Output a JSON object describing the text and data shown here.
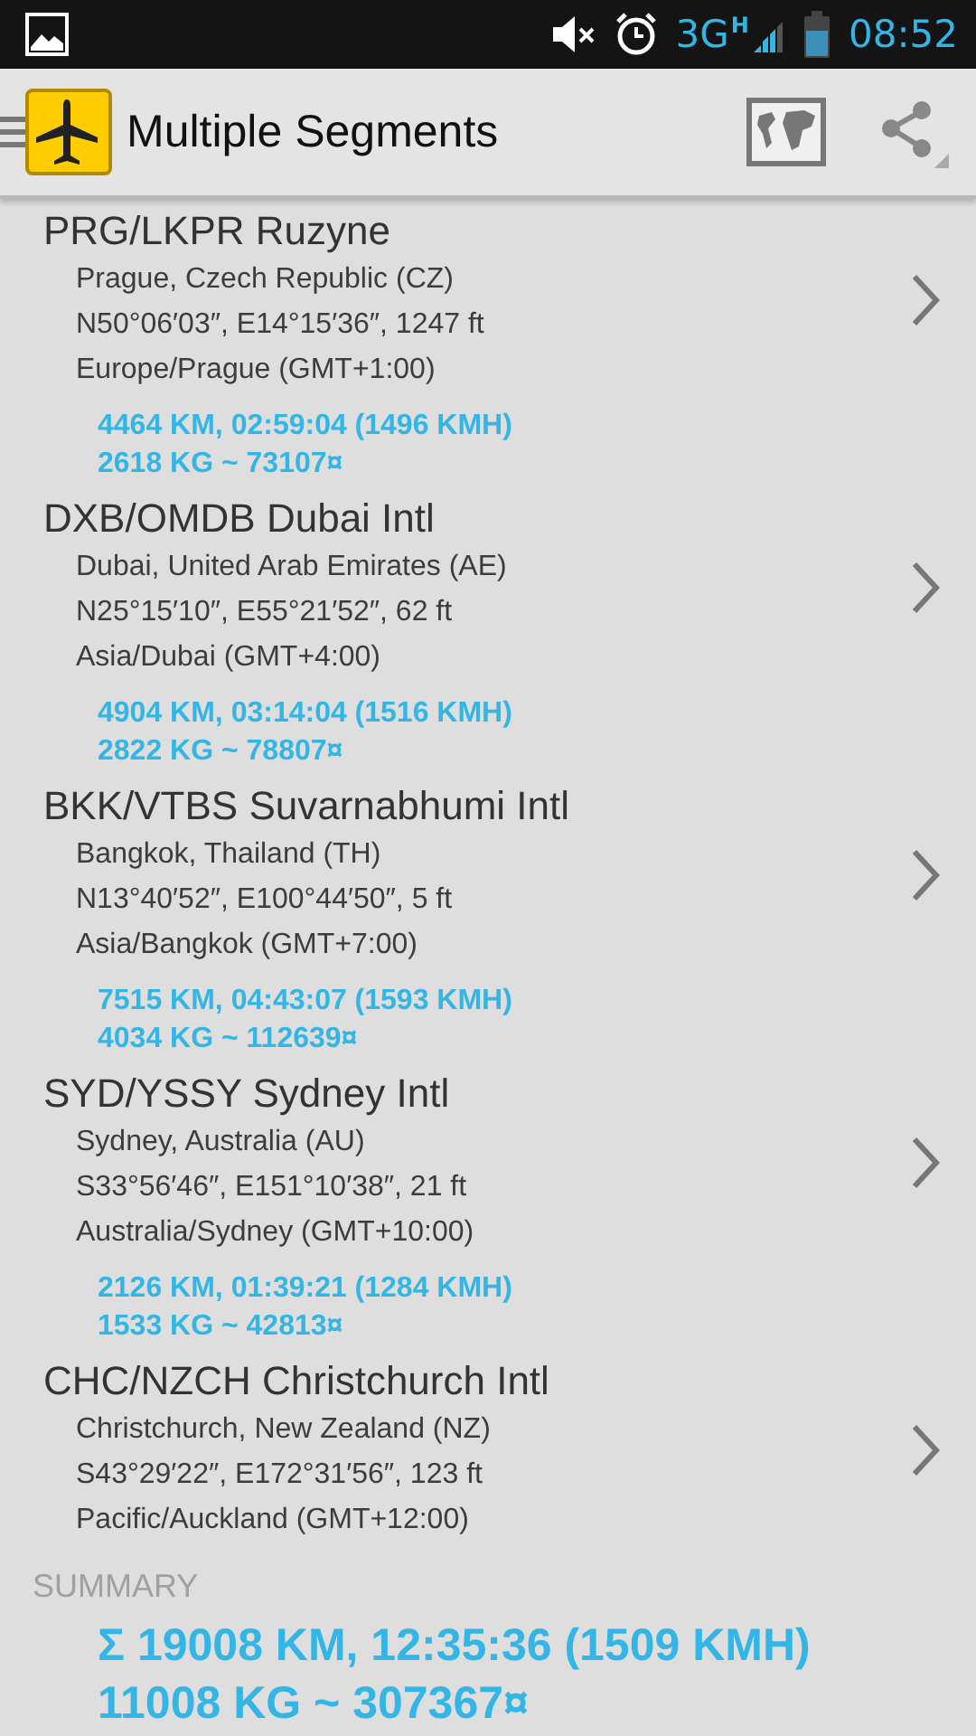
{
  "status_bar": {
    "network": "3G",
    "network_type": "H",
    "time": "08:52"
  },
  "action_bar": {
    "title": "Multiple Segments"
  },
  "airports": [
    {
      "name": "PRG/LKPR Ruzyne",
      "location": "Prague, Czech Republic (CZ)",
      "coordinates": "N50°06′03″, E14°15′36″, 1247 ft",
      "timezone": "Europe/Prague (GMT+1:00)",
      "leg": {
        "distance": "4464 KM, 02:59:04 (1496 KMH)",
        "fuel": "2618 KG ~ 73107¤"
      }
    },
    {
      "name": "DXB/OMDB Dubai Intl",
      "location": "Dubai, United Arab Emirates (AE)",
      "coordinates": "N25°15′10″, E55°21′52″, 62 ft",
      "timezone": "Asia/Dubai (GMT+4:00)",
      "leg": {
        "distance": "4904 KM, 03:14:04 (1516 KMH)",
        "fuel": "2822 KG ~ 78807¤"
      }
    },
    {
      "name": "BKK/VTBS Suvarnabhumi Intl",
      "location": "Bangkok, Thailand (TH)",
      "coordinates": "N13°40′52″, E100°44′50″, 5 ft",
      "timezone": "Asia/Bangkok (GMT+7:00)",
      "leg": {
        "distance": "7515 KM, 04:43:07 (1593 KMH)",
        "fuel": "4034 KG ~ 112639¤"
      }
    },
    {
      "name": "SYD/YSSY Sydney Intl",
      "location": "Sydney, Australia (AU)",
      "coordinates": "S33°56′46″, E151°10′38″, 21 ft",
      "timezone": "Australia/Sydney (GMT+10:00)",
      "leg": {
        "distance": "2126 KM, 01:39:21 (1284 KMH)",
        "fuel": "1533 KG ~ 42813¤"
      }
    },
    {
      "name": "CHC/NZCH Christchurch Intl",
      "location": "Christchurch, New Zealand (NZ)",
      "coordinates": "S43°29′22″, E172°31′56″, 123 ft",
      "timezone": "Pacific/Auckland (GMT+12:00)"
    }
  ],
  "summary": {
    "heading": "SUMMARY",
    "distance": "Σ 19008 KM, 12:35:36 (1509 KMH)",
    "fuel": "11008 KG ~ 307367¤"
  }
}
